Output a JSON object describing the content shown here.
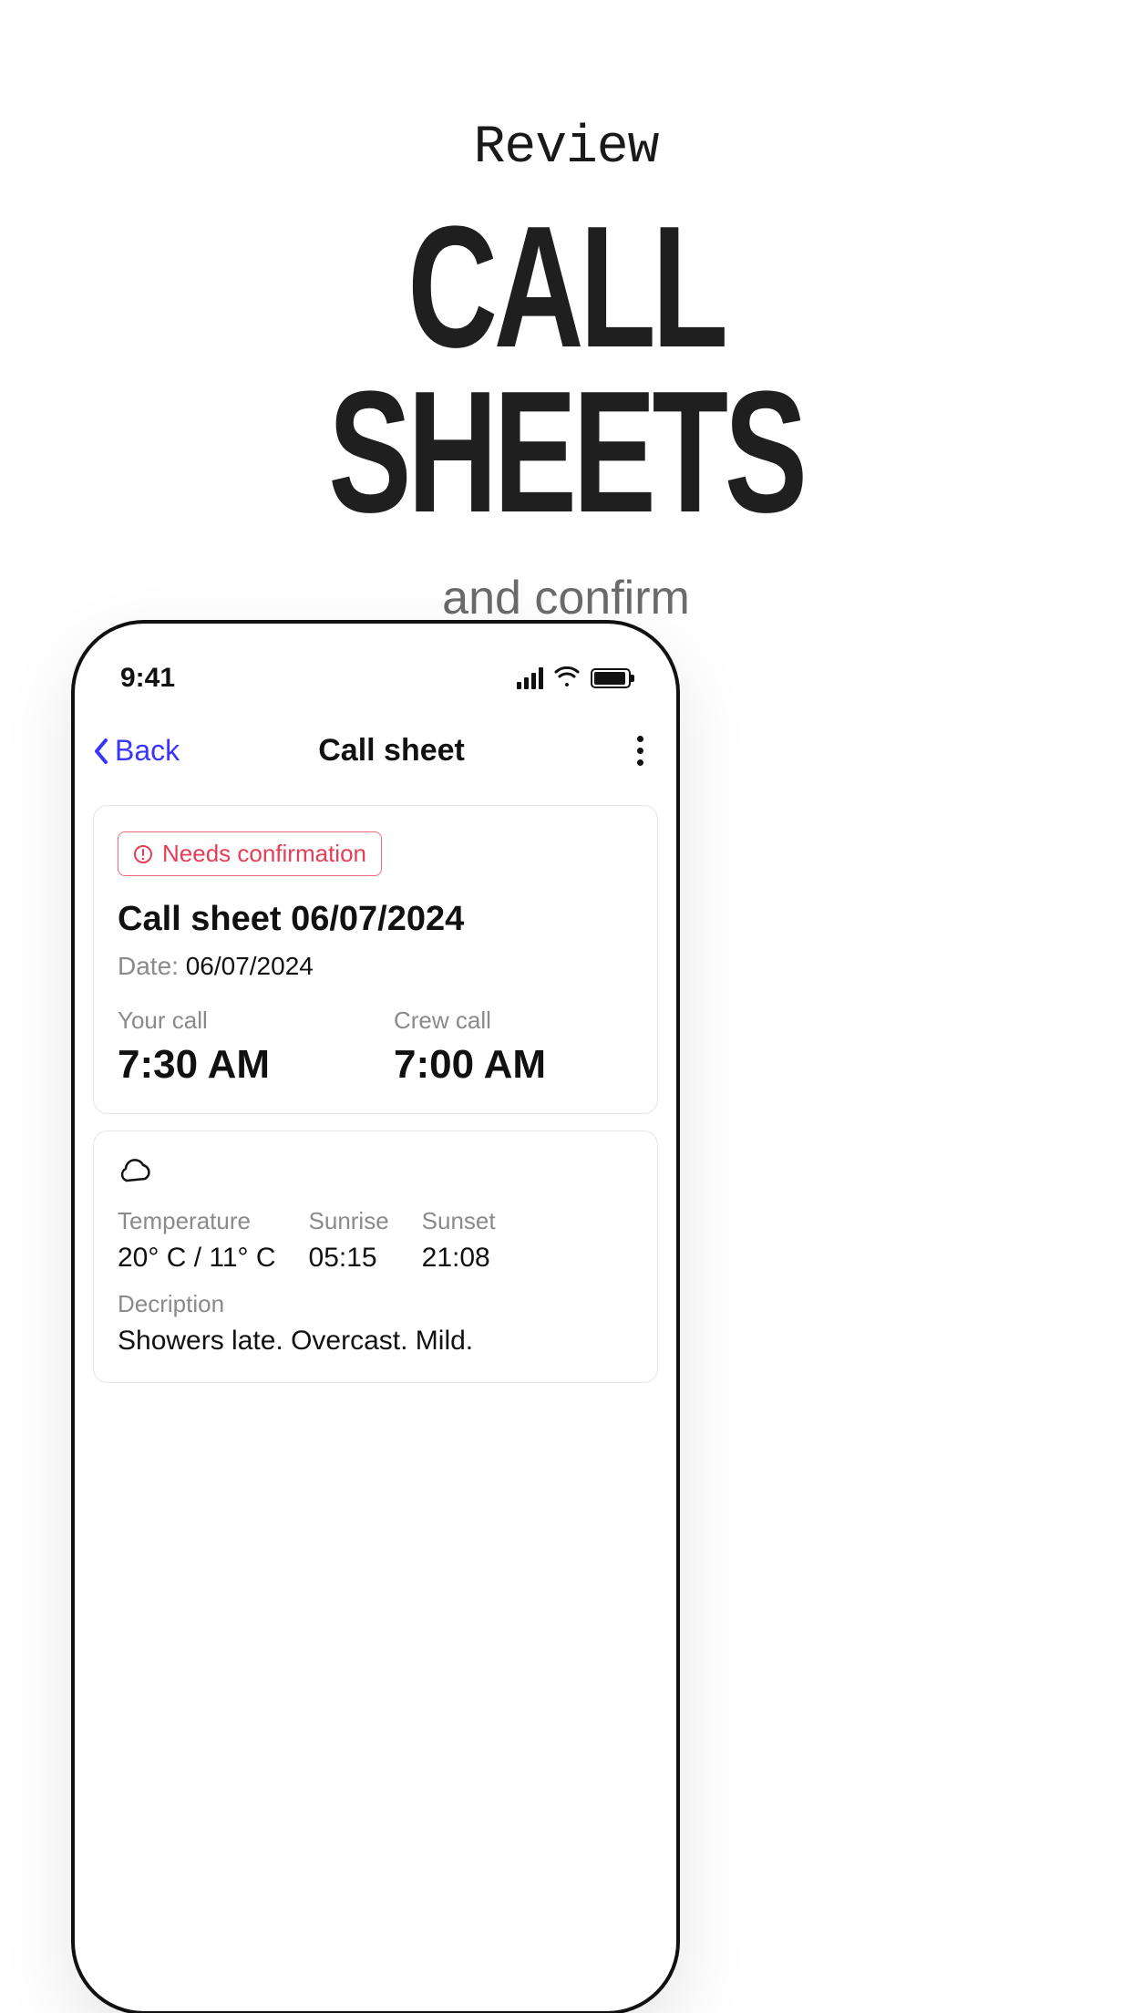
{
  "promo": {
    "line1": "Review",
    "line2": "CALL\nSHEETS",
    "line3": "and confirm"
  },
  "statusbar": {
    "time": "9:41"
  },
  "navbar": {
    "back": "Back",
    "title": "Call sheet"
  },
  "callsheet": {
    "badge": "Needs confirmation",
    "title": "Call sheet 06/07/2024",
    "date_label": "Date: ",
    "date_value": "06/07/2024",
    "your_call_label": "Your call",
    "your_call_value": "7:30 AM",
    "crew_call_label": "Crew call",
    "crew_call_value": "7:00 AM"
  },
  "weather": {
    "temperature_label": "Temperature",
    "temperature_value": "20° C / 11° C",
    "sunrise_label": "Sunrise",
    "sunrise_value": "05:15",
    "sunset_label": "Sunset",
    "sunset_value": "21:08",
    "description_label": "Decription",
    "description_value": "Showers late. Overcast. Mild."
  }
}
